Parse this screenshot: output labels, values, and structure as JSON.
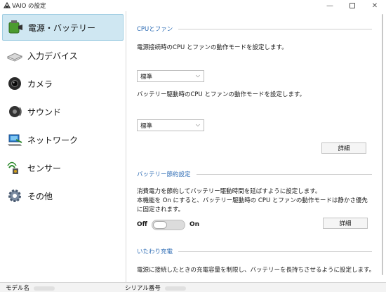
{
  "window": {
    "title": "VAIO の設定",
    "controls": [
      "minimize",
      "maximize",
      "close"
    ]
  },
  "sidebar": {
    "items": [
      {
        "label": "電源・バッテリー",
        "icon": "battery-icon",
        "selected": true
      },
      {
        "label": "入力デバイス",
        "icon": "keyboard-icon",
        "selected": false
      },
      {
        "label": "カメラ",
        "icon": "camera-icon",
        "selected": false
      },
      {
        "label": "サウンド",
        "icon": "speaker-icon",
        "selected": false
      },
      {
        "label": "ネットワーク",
        "icon": "network-icon",
        "selected": false
      },
      {
        "label": "センサー",
        "icon": "sensor-icon",
        "selected": false
      },
      {
        "label": "その他",
        "icon": "gear-icon",
        "selected": false
      }
    ]
  },
  "main": {
    "cpu_fan": {
      "title": "CPUとファン",
      "ac_description": "電源接続時のCPU とファンの動作モードを設定します。",
      "ac_mode": "標準",
      "battery_description": "バッテリー駆動時のCPU とファンの動作モードを設定します。",
      "battery_mode": "標準",
      "details_label": "詳細"
    },
    "battery_saving": {
      "title": "バッテリー節約設定",
      "line1": "消費電力を節約してバッテリー駆動時間を延ばすように設定します。",
      "line2": "本機能を On にすると、バッテリー駆動時の CPU とファンの動作モードは静かさ優先",
      "line3": "に固定されます。",
      "toggle_off_label": "Off",
      "toggle_on_label": "On",
      "toggle_state": "off",
      "details_label": "詳細"
    },
    "gentle_charging": {
      "title": "いたわり充電",
      "description": "電源に接続したときの充電容量を制限し、バッテリーを長持ちさせるように設定します。"
    }
  },
  "statusbar": {
    "model_label": "モデル名",
    "serial_label": "シリアル番号"
  }
}
